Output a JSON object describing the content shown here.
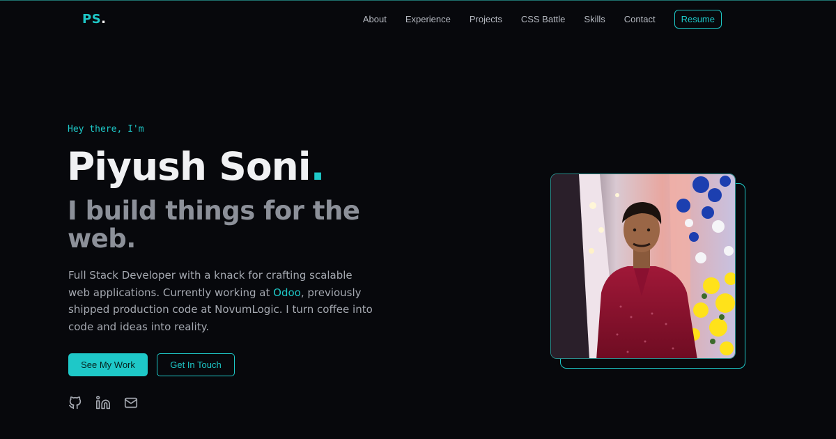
{
  "logo": {
    "text": "PS",
    "dot": "."
  },
  "nav": {
    "items": [
      "About",
      "Experience",
      "Projects",
      "CSS Battle",
      "Skills",
      "Contact"
    ],
    "resume_label": "Resume"
  },
  "hero": {
    "greeting": "Hey there, I'm",
    "name": "Piyush Soni",
    "name_dot": ".",
    "tagline": "I build things for the web.",
    "bio_before": "Full Stack Developer with a knack for crafting scalable web applications. Currently working at ",
    "bio_highlight": "Odoo",
    "bio_after": ", previously shipped production code at NovumLogic. I turn coffee into code and ideas into reality.",
    "primary_button": "See My Work",
    "secondary_button": "Get In Touch"
  },
  "socials": [
    {
      "icon": "github-icon"
    },
    {
      "icon": "linkedin-icon"
    },
    {
      "icon": "mail-icon"
    }
  ],
  "colors": {
    "background": "#07080c",
    "accent": "#1ec8c8",
    "heading": "#f0f1f3",
    "muted": "#8c9099"
  }
}
